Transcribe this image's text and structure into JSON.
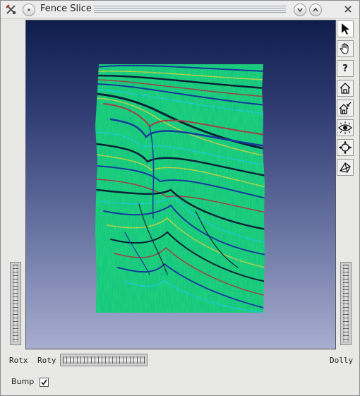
{
  "window": {
    "title": "Fence Slice"
  },
  "titlebar_icons": [
    "app-tools-icon",
    "window-menu-icon",
    "minimize-icon",
    "maximize-icon",
    "close-icon"
  ],
  "viewer": {
    "background_top": "#0f1d4c",
    "background_bottom": "#a8aed0",
    "slice_colors": [
      "#22e066",
      "#1fd8d8",
      "#1a2a9a",
      "#d8df35",
      "#c23030",
      "#0c0c20"
    ]
  },
  "toolbar": {
    "tools": [
      {
        "name": "select-pointer-icon"
      },
      {
        "name": "pan-hand-icon"
      },
      {
        "name": "help-icon",
        "label": "?"
      },
      {
        "name": "home-icon"
      },
      {
        "name": "set-home-icon"
      },
      {
        "name": "view-all-icon"
      },
      {
        "name": "seek-icon"
      },
      {
        "name": "projection-toggle-icon"
      }
    ]
  },
  "controls": {
    "rotx_label": "Rotx",
    "roty_label": "Roty",
    "dolly_label": "Dolly",
    "bump_label": "Bump",
    "bump_checked": true
  }
}
